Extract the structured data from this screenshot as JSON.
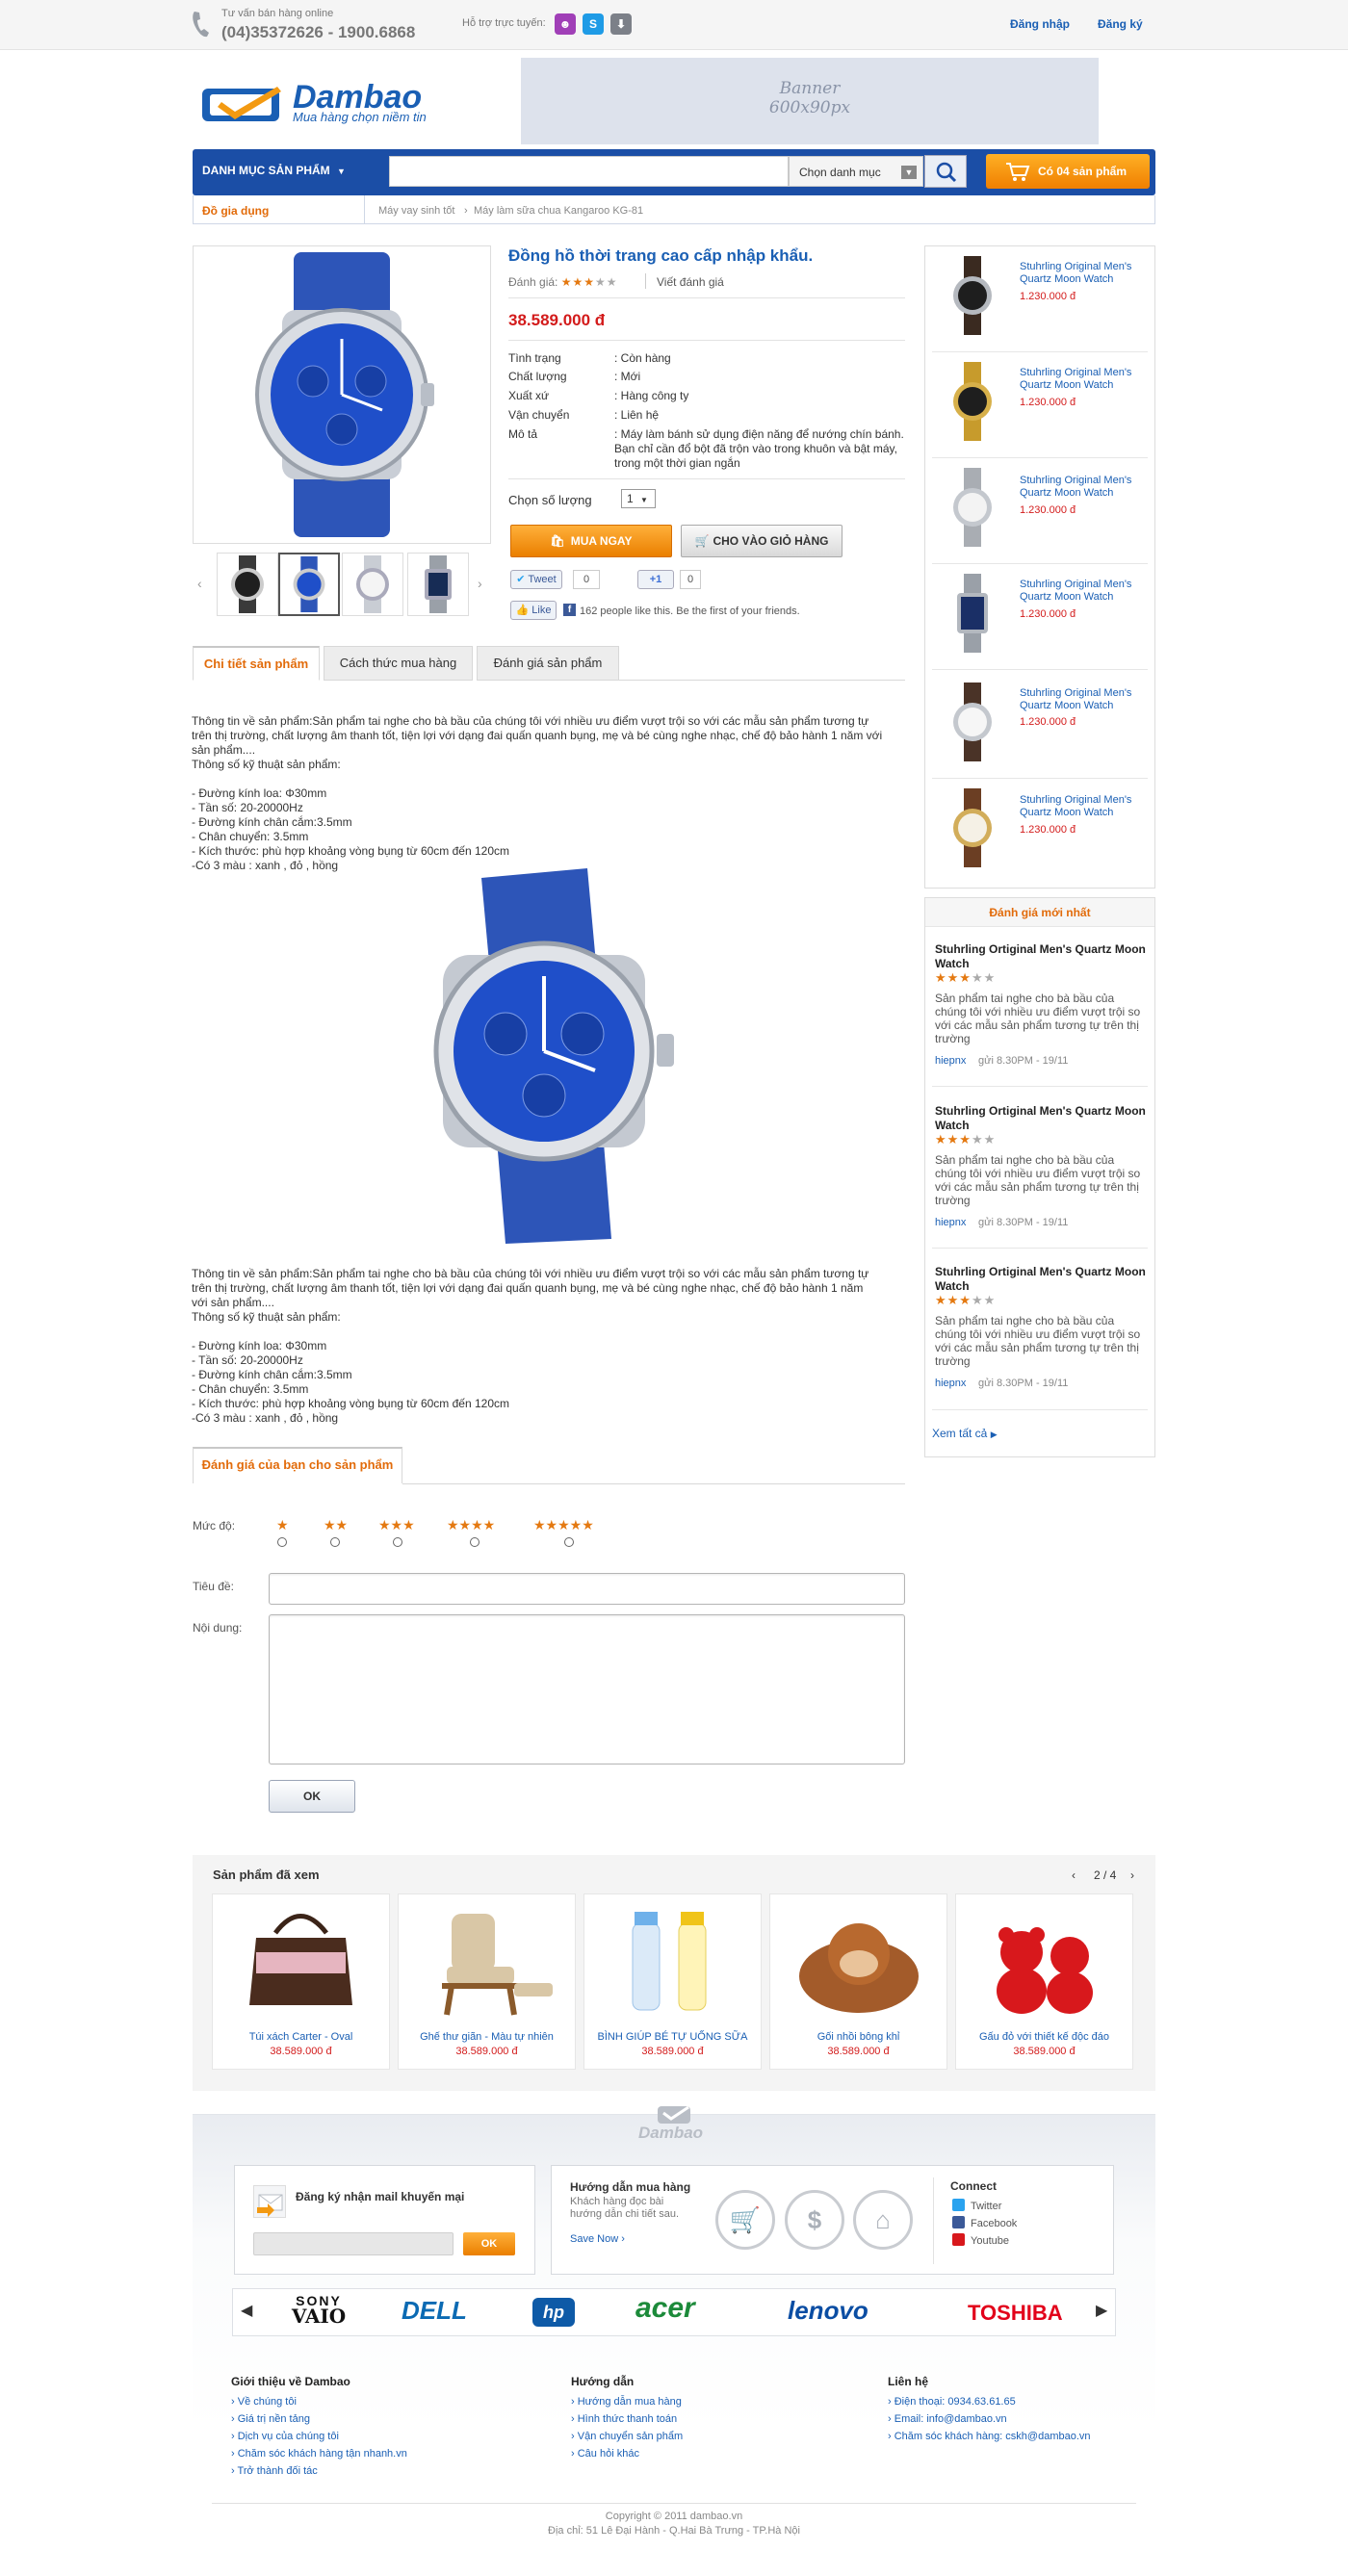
{
  "topbar": {
    "support_label": "Tư vấn bán hàng online",
    "support_phone": "(04)35372626 - 1900.6868",
    "online_label": "Hỗ trợ trực tuyến:",
    "login": "Đăng nhập",
    "register": "Đăng ký"
  },
  "header": {
    "logo_name": "Dambao",
    "logo_slogan": "Mua hàng chọn niềm tin",
    "banner_line1": "Banner",
    "banner_line2": "600x90px"
  },
  "nav": {
    "category_menu": "DANH MỤC SẢN PHẨM",
    "search_placeholder": "",
    "search_category": "Chọn danh mục",
    "cart": "Có 04 sản phẩm"
  },
  "breadcrumb": {
    "category": "Đồ gia dụng",
    "items": [
      "Máy vay sinh tốt",
      "Máy làm sữa chua Kangaroo KG-81"
    ]
  },
  "product": {
    "title": "Đồng hồ thời trang cao cấp nhập khẩu.",
    "rating_label": "Đánh giá:",
    "rating_stars_on": "★★★",
    "rating_stars_off": "★★",
    "rating_value": 3,
    "write_review": "Viết đánh giá",
    "price": "38.589.000 đ",
    "specs": [
      {
        "key": "Tình trạng",
        "value": ": Còn hàng"
      },
      {
        "key": "Chất lượng",
        "value": ": Mới"
      },
      {
        "key": "Xuất xứ",
        "value": ": Hàng công ty"
      },
      {
        "key": "Vận chuyển",
        "value": ": Liên hệ"
      },
      {
        "key": "Mô tả",
        "value": ": Máy làm bánh sử dụng điện năng để nướng chín bánh. Bạn chỉ cần đổ bột đã trộn vào trong khuôn và bật máy, trong một thời gian ngắn"
      }
    ],
    "qty_label": "Chọn số lượng",
    "qty_value": "1",
    "buy_now": "MUA NGAY",
    "add_to_cart": "CHO VÀO GIỎ HÀNG",
    "tweet": "Tweet",
    "tweet_count": "0",
    "plus_one": "+1",
    "plus_count": "0",
    "like": "Like",
    "like_text": "162 people like this. Be the first of your friends."
  },
  "tabs": [
    "Chi tiết sản phẩm",
    "Cách thức mua hàng",
    "Đánh giá sản phẩm"
  ],
  "description": {
    "lines_top": [
      "Thông tin về sản phẩm:Sản phẩm tai nghe cho bà bầu của chúng tôi với nhiều ưu điểm vượt trội so với các mẫu sản phẩm tương tự",
      "trên thị trường, chất lượng âm thanh tốt, tiện lợi với dạng đai quấn quanh bụng, mẹ và bé cùng nghe nhạc, chế độ bảo hành 1 năm với",
      "sản phẩm....",
      "Thông số kỹ thuật sản phẩm:",
      "",
      "- Đường kính loa: Φ30mm",
      "- Tần số: 20-20000Hz",
      "- Đường kính chân cắm:3.5mm",
      "- Chân chuyển: 3.5mm",
      "- Kích thước: phù hợp khoảng vòng bụng từ 60cm đến 120cm",
      "-Có 3 màu : xanh , đỏ , hồng"
    ],
    "lines_bottom": [
      "Thông tin về sản phẩm:Sản phẩm tai nghe cho bà bầu của chúng tôi với nhiều ưu điểm vượt trội so với các mẫu sản phẩm tương tự",
      "trên thị trường, chất lượng âm thanh tốt, tiện lợi với dạng đai quấn quanh bụng, mẹ và bé cùng nghe nhạc, chế độ bảo hành 1 năm",
      "với sản phẩm....",
      "Thông số kỹ thuật sản phẩm:",
      "",
      "- Đường kính loa: Φ30mm",
      "- Tần số: 20-20000Hz",
      "- Đường kính chân cắm:3.5mm",
      "- Chân chuyển: 3.5mm",
      "- Kích thước: phù hợp khoảng vòng bụng từ 60cm đến 120cm",
      "-Có 3 màu : xanh , đỏ , hồng"
    ]
  },
  "review_form": {
    "tab": "Đánh giá của bạn cho sản phẩm",
    "level_label": "Mức độ:",
    "levels": [
      "★",
      "★★",
      "★★★",
      "★★★★",
      "★★★★★"
    ],
    "title_label": "Tiêu đề:",
    "content_label": "Nội dung:",
    "submit": "OK"
  },
  "sidebar_products": [
    {
      "name": "Stuhrling Original Men's Quartz Moon Watch",
      "price": "1.230.000 đ"
    },
    {
      "name": "Stuhrling Original Men's Quartz Moon Watch",
      "price": "1.230.000 đ"
    },
    {
      "name": "Stuhrling Original Men's Quartz Moon Watch",
      "price": "1.230.000 đ"
    },
    {
      "name": "Stuhrling Original Men's Quartz Moon Watch",
      "price": "1.230.000 đ"
    },
    {
      "name": "Stuhrling Original Men's Quartz Moon Watch",
      "price": "1.230.000 đ"
    },
    {
      "name": "Stuhrling Original Men's Quartz Moon Watch",
      "price": "1.230.000 đ"
    }
  ],
  "latest_reviews": {
    "title": "Đánh giá mới nhất",
    "items": [
      {
        "title": "Stuhrling Ortiginal Men's Quartz Moon Watch",
        "stars_on": "★★★",
        "stars_off": "★★",
        "rating": 3,
        "text": "Sản phẩm tai nghe cho bà bầu của chúng tôi với nhiều ưu điểm vượt trội so với các mẫu sản phẩm tương tự trên thị trường",
        "user": "hiepnx",
        "time": "gửi 8.30PM - 19/11"
      },
      {
        "title": "Stuhrling Ortiginal Men's Quartz Moon Watch",
        "stars_on": "★★★",
        "stars_off": "★★",
        "rating": 3,
        "text": "Sản phẩm tai nghe cho bà bầu của chúng tôi với nhiều ưu điểm vượt trội so với các mẫu sản phẩm tương tự trên thị trường",
        "user": "hiepnx",
        "time": "gửi 8.30PM - 19/11"
      },
      {
        "title": "Stuhrling Ortiginal Men's Quartz Moon Watch",
        "stars_on": "★★★",
        "stars_off": "★★",
        "rating": 3,
        "text": "Sản phẩm tai nghe cho bà bầu của chúng tôi với nhiều ưu điểm vượt trội so với các mẫu sản phẩm tương tự trên thị trường",
        "user": "hiepnx",
        "time": "gửi 8.30PM - 19/11"
      }
    ],
    "see_all": "Xem tất cả"
  },
  "viewed": {
    "title": "Sản phẩm đã xem",
    "pager": "2 / 4",
    "items": [
      {
        "name": "Túi xách Carter - Oval",
        "price": "38.589.000 đ"
      },
      {
        "name": "Ghế thư giãn - Màu tự nhiên",
        "price": "38.589.000 đ"
      },
      {
        "name": "BÌNH GIÚP BÉ TỰ UỐNG SỮA",
        "price": "38.589.000 đ"
      },
      {
        "name": "Gối nhồi bông khỉ",
        "price": "38.589.000 đ"
      },
      {
        "name": "Gấu đỏ với thiết kế độc đáo",
        "price": "38.589.000 đ"
      }
    ]
  },
  "footer": {
    "logo": "Dambao",
    "newsletter_title": "Đăng ký nhận mail khuyến mại",
    "newsletter_ok": "OK",
    "guide_title": "Hướng dẫn mua hàng",
    "guide_desc": "Khách hàng đọc bài hướng dẫn chi tiết sau.",
    "guide_link": "Save Now",
    "connect_title": "Connect",
    "connect_items": [
      "Twitter",
      "Facebook",
      "Youtube"
    ],
    "brands": [
      "SONY VAIO",
      "DELL",
      "hp",
      "acer",
      "lenovo",
      "TOSHIBA"
    ],
    "brand_sony_top": "SONY",
    "brand_sony_bottom": "VAIO",
    "col1_title": "Giới thiệu về Dambao",
    "col1": [
      "Về chúng tôi",
      "Giá trị nền tảng",
      "Dịch vụ của chúng tôi",
      "Chăm sóc khách hàng tận nhanh.vn",
      "Trở thành đối tác"
    ],
    "col2_title": "Hướng dẫn",
    "col2": [
      "Hướng dẫn mua hàng",
      "Hình thức thanh toán",
      "Vận chuyển sản phẩm",
      "Câu hỏi khác"
    ],
    "col3_title": "Liên hệ",
    "col3": [
      "Điện thoại: 0934.63.61.65",
      "Email: info@dambao.vn",
      "Chăm sóc khách hàng: cskh@dambao.vn"
    ],
    "copyright": "Copyright © 2011 dambao.vn",
    "address": "Địa chỉ: 51 Lê Đại Hành - Q.Hai Bà Trưng - TP.Hà Nội"
  },
  "colors": {
    "brand_blue": "#1b4ea6",
    "accent_orange": "#e26b0a",
    "price_red": "#d31b1b"
  }
}
